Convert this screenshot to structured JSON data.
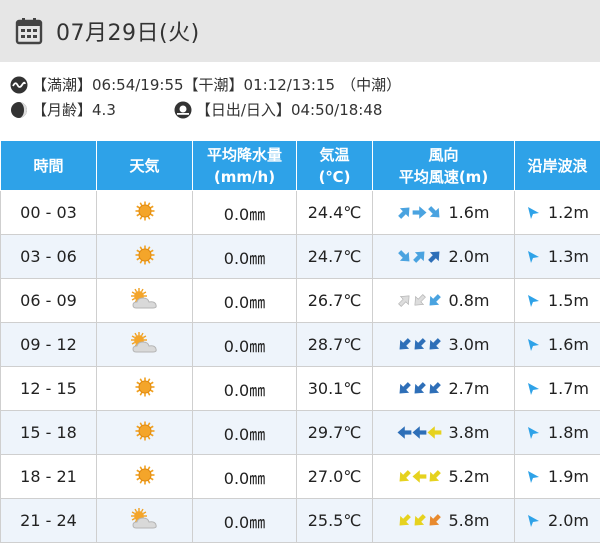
{
  "header": {
    "date": "07月29日(火)"
  },
  "tide": {
    "high_label": "【満潮】",
    "high_value": "06:54/19:55",
    "low_label": "【干潮】",
    "low_value": "01:12/13:15",
    "tide_type": "（中潮）",
    "moon_label": "【月齢】",
    "moon_value": "4.3",
    "sun_label": "【日出/日入】",
    "sun_value": "04:50/18:48"
  },
  "table": {
    "headers": {
      "time": "時間",
      "weather": "天気",
      "rain_1": "平均降水量",
      "rain_2": "(mm/h)",
      "temp_1": "気温",
      "temp_2": "(℃)",
      "wind_1": "風向",
      "wind_2": "平均風速(m)",
      "wave": "沿岸波浪"
    },
    "rows": [
      {
        "time": "00 - 03",
        "weather": "sunny-icon",
        "rain": "0.0㎜",
        "temp": "24.4℃",
        "wind_dirs": [
          45,
          90,
          135
        ],
        "wind_colors": [
          "#4aa3e0",
          "#4aa3e0",
          "#4aa3e0"
        ],
        "wind_speed": "1.6m",
        "wave": "1.2m"
      },
      {
        "time": "03 - 06",
        "weather": "sunny-icon",
        "rain": "0.0㎜",
        "temp": "24.7℃",
        "wind_dirs": [
          135,
          45,
          45
        ],
        "wind_colors": [
          "#4aa3e0",
          "#4aa3e0",
          "#2e6fb8"
        ],
        "wind_speed": "2.0m",
        "wave": "1.3m"
      },
      {
        "time": "06 - 09",
        "weather": "sun-cloud-icon",
        "rain": "0.0㎜",
        "temp": "26.7℃",
        "wind_dirs": [
          45,
          225,
          225
        ],
        "wind_colors": [
          "#dddddd",
          "#dddddd",
          "#4aa3e0"
        ],
        "wind_speed": "0.8m",
        "wave": "1.5m"
      },
      {
        "time": "09 - 12",
        "weather": "sun-cloud-icon",
        "rain": "0.0㎜",
        "temp": "28.7℃",
        "wind_dirs": [
          225,
          225,
          225
        ],
        "wind_colors": [
          "#2e6fb8",
          "#2e6fb8",
          "#2e6fb8"
        ],
        "wind_speed": "3.0m",
        "wave": "1.6m"
      },
      {
        "time": "12 - 15",
        "weather": "sunny-icon",
        "rain": "0.0㎜",
        "temp": "30.1℃",
        "wind_dirs": [
          225,
          225,
          225
        ],
        "wind_colors": [
          "#2e6fb8",
          "#2e6fb8",
          "#2e6fb8"
        ],
        "wind_speed": "2.7m",
        "wave": "1.7m"
      },
      {
        "time": "15 - 18",
        "weather": "sunny-icon",
        "rain": "0.0㎜",
        "temp": "29.7℃",
        "wind_dirs": [
          270,
          270,
          270
        ],
        "wind_colors": [
          "#2e6fb8",
          "#2e6fb8",
          "#e6d21e"
        ],
        "wind_speed": "3.8m",
        "wave": "1.8m"
      },
      {
        "time": "18 - 21",
        "weather": "sunny-icon",
        "rain": "0.0㎜",
        "temp": "27.0℃",
        "wind_dirs": [
          225,
          270,
          225
        ],
        "wind_colors": [
          "#e6d21e",
          "#e6d21e",
          "#e6d21e"
        ],
        "wind_speed": "5.2m",
        "wave": "1.9m"
      },
      {
        "time": "21 - 24",
        "weather": "sun-cloud-icon",
        "rain": "0.0㎜",
        "temp": "25.5℃",
        "wind_dirs": [
          225,
          225,
          225
        ],
        "wind_colors": [
          "#e6d21e",
          "#e6d21e",
          "#e88a2e"
        ],
        "wind_speed": "5.8m",
        "wave": "2.0m"
      }
    ]
  }
}
